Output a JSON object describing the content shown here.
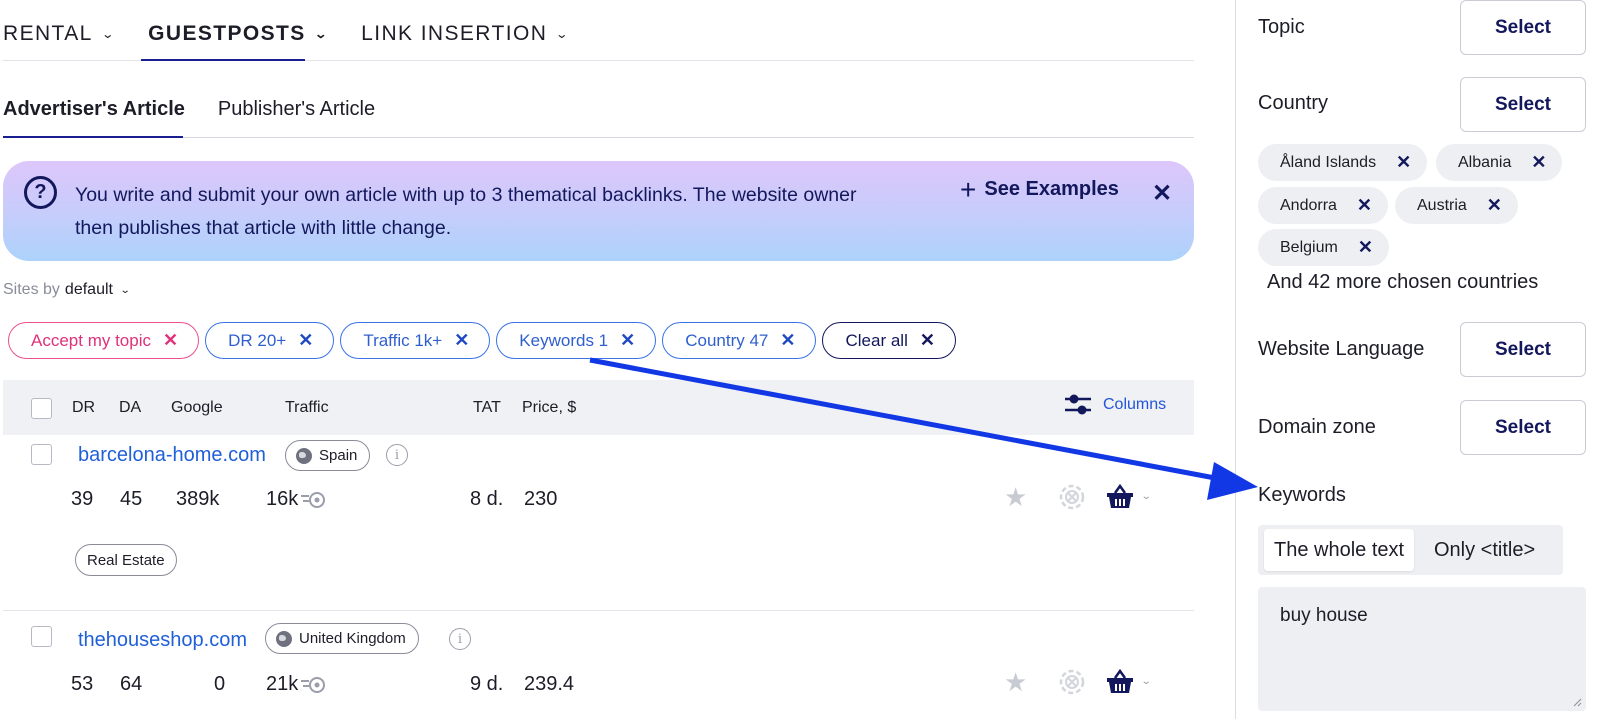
{
  "nav": {
    "items": [
      {
        "label": "RENTAL",
        "active": false
      },
      {
        "label": "GUESTPOSTS",
        "active": true
      },
      {
        "label": "LINK INSERTION",
        "active": false
      }
    ]
  },
  "tabs": [
    {
      "label": "Advertiser's Article",
      "active": true
    },
    {
      "label": "Publisher's Article",
      "active": false
    }
  ],
  "banner": {
    "text": "You write and submit your own article with up to 3 thematical backlinks. The website owner then publishes that article with little change.",
    "see_examples": "See Examples"
  },
  "sort": {
    "prefix": "Sites by",
    "value": "default"
  },
  "filters": [
    {
      "label": "Accept my topic",
      "style": "pink"
    },
    {
      "label": "DR 20+",
      "style": "blue"
    },
    {
      "label": "Traffic 1k+",
      "style": "blue"
    },
    {
      "label": "Keywords 1",
      "style": "blue"
    },
    {
      "label": "Country 47",
      "style": "blue"
    },
    {
      "label": "Clear all",
      "style": "dark"
    }
  ],
  "table": {
    "headers": {
      "dr": "DR",
      "da": "DA",
      "google": "Google",
      "traffic": "Traffic",
      "tat": "TAT",
      "price": "Price, $"
    },
    "columns_label": "Columns",
    "rows": [
      {
        "site": "barcelona-home.com",
        "country": "Spain",
        "dr": "39",
        "da": "45",
        "google": "389k",
        "traffic": "16k",
        "tat": "8 d.",
        "price": "230",
        "tag": "Real Estate"
      },
      {
        "site": "thehouseshop.com",
        "country": "United Kingdom",
        "dr": "53",
        "da": "64",
        "google": "0",
        "traffic": "21k",
        "tat": "9 d.",
        "price": "239.4"
      }
    ]
  },
  "panel": {
    "select_label": "Select",
    "topic": "Topic",
    "country": "Country",
    "countries": [
      "Åland Islands",
      "Albania",
      "Andorra",
      "Austria",
      "Belgium"
    ],
    "more_countries": "And 42 more chosen countries",
    "website_language": "Website Language",
    "domain_zone": "Domain zone",
    "keywords": "Keywords",
    "kw_mode_whole": "The whole text",
    "kw_mode_title": "Only <title>",
    "kw_value": "buy house"
  },
  "colors": {
    "accent_navy": "#13175c",
    "link_blue": "#1f5fd8",
    "chip_blue": "#3a72e8",
    "chip_pink": "#ee4f8d",
    "arrow_blue": "#1238e6"
  }
}
